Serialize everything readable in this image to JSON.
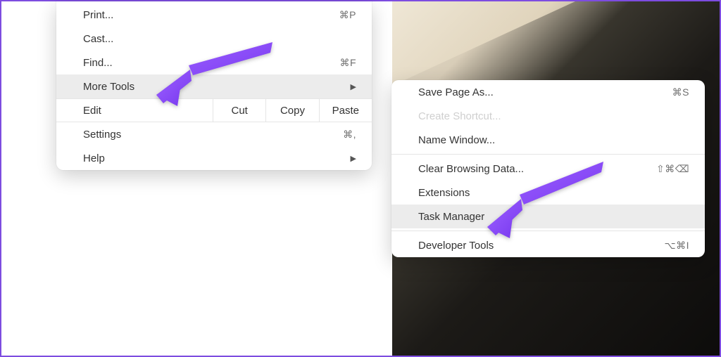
{
  "main_menu": {
    "print": {
      "label": "Print...",
      "hotkey": "⌘P"
    },
    "cast": {
      "label": "Cast..."
    },
    "find": {
      "label": "Find...",
      "hotkey": "⌘F"
    },
    "more_tools": {
      "label": "More Tools",
      "arrow": "▶"
    },
    "edit": {
      "label": "Edit",
      "cut": "Cut",
      "copy": "Copy",
      "paste": "Paste"
    },
    "settings": {
      "label": "Settings",
      "hotkey": "⌘,"
    },
    "help": {
      "label": "Help",
      "arrow": "▶"
    }
  },
  "more_tools_menu": {
    "save_page": {
      "label": "Save Page As...",
      "hotkey": "⌘S"
    },
    "create_shortcut": {
      "label": "Create Shortcut..."
    },
    "name_window": {
      "label": "Name Window..."
    },
    "clear_data": {
      "label": "Clear Browsing Data...",
      "hotkey": "⇧⌘⌫"
    },
    "extensions": {
      "label": "Extensions"
    },
    "task_manager": {
      "label": "Task Manager"
    },
    "developer_tools": {
      "label": "Developer Tools",
      "hotkey": "⌥⌘I"
    }
  }
}
